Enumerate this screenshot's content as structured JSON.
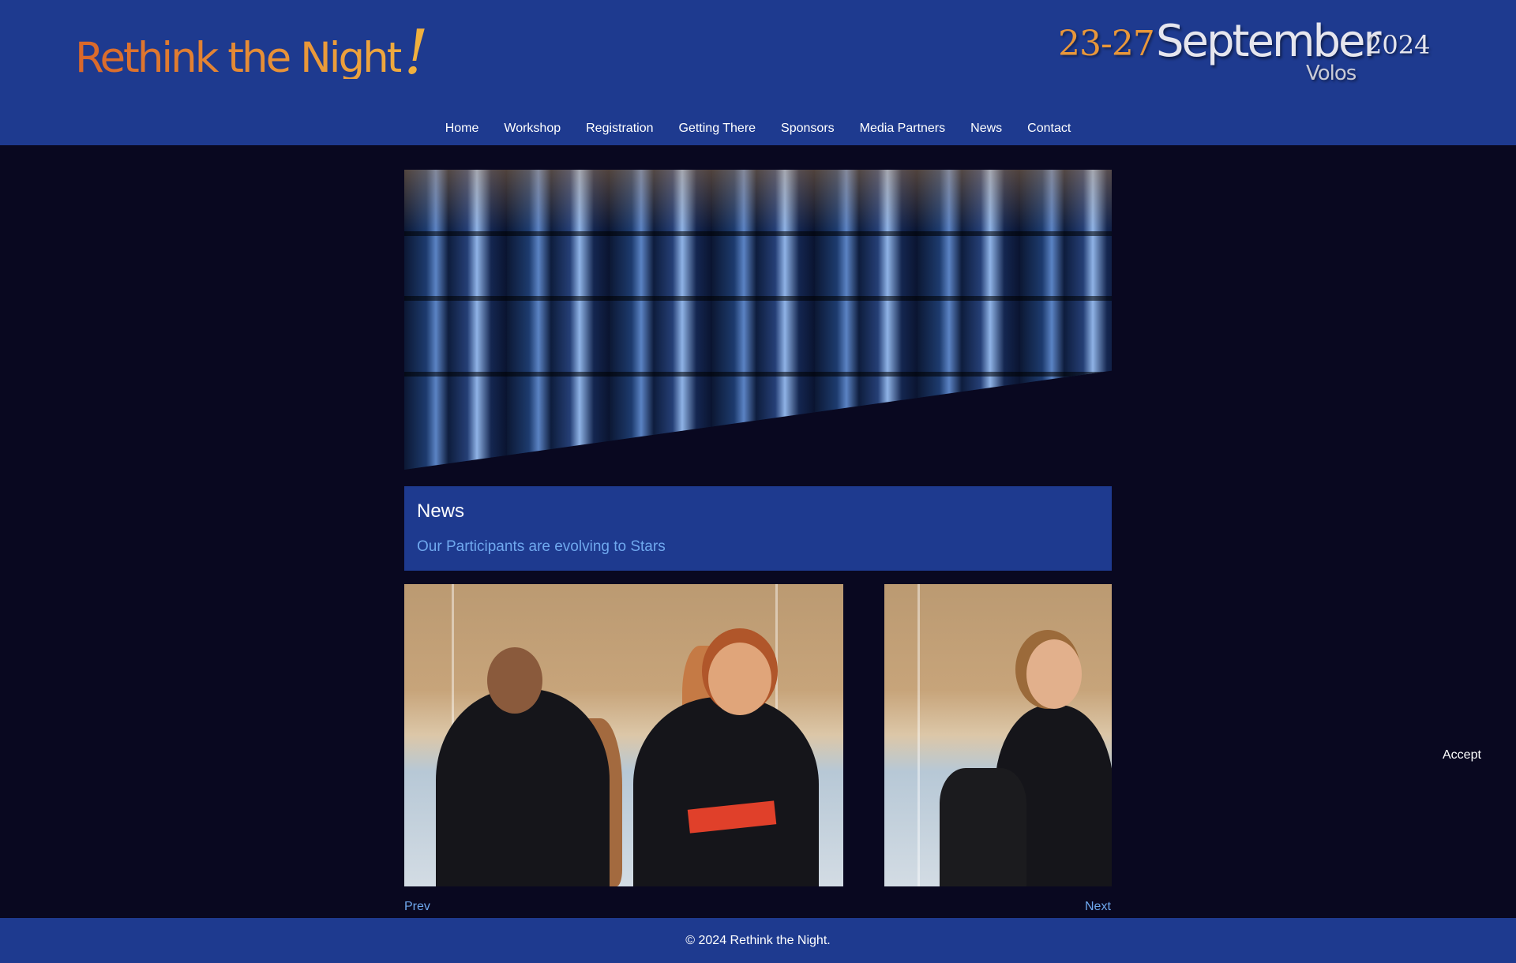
{
  "header": {
    "logo": "Rethink the Night",
    "logo_mark": "!",
    "dates_range": "23-27",
    "dates_month": "September",
    "dates_year": "2024",
    "dates_city": "Volos",
    "nav": [
      {
        "label": "Home"
      },
      {
        "label": "Workshop"
      },
      {
        "label": "Registration"
      },
      {
        "label": "Getting There"
      },
      {
        "label": "Sponsors"
      },
      {
        "label": "Media Partners"
      },
      {
        "label": "News"
      },
      {
        "label": "Contact"
      }
    ]
  },
  "news": {
    "heading": "News",
    "article_title": "Our Participants are evolving to Stars"
  },
  "carousel": {
    "prev_label": "Prev",
    "next_label": "Next"
  },
  "cookie": {
    "accept_label": "Accept"
  },
  "footer": {
    "copyright": "© 2024 Rethink the Night."
  },
  "colors": {
    "header_bg": "#1e3a8f",
    "page_bg": "#090820",
    "link": "#6fa8ee",
    "logo_orange": "#e58a35"
  }
}
